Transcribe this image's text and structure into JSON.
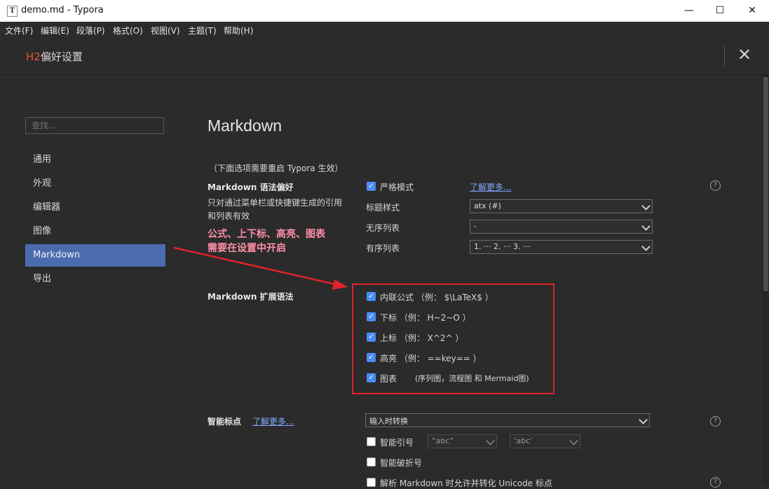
{
  "window": {
    "title": "demo.md - Typora",
    "app_icon": "T",
    "minimize": "—",
    "maximize": "☐",
    "close": "✕"
  },
  "menu": [
    "文件(F)",
    "编辑(E)",
    "段落(P)",
    "格式(O)",
    "视图(V)",
    "主题(T)",
    "帮助(H)"
  ],
  "preferences": {
    "header_prefix": "H2",
    "header_title": "偏好设置",
    "close_symbol": "✕"
  },
  "sidebar": {
    "search_placeholder": "查找...",
    "items": [
      "通用",
      "外观",
      "编辑器",
      "图像",
      "Markdown",
      "导出"
    ],
    "active": "Markdown"
  },
  "main": {
    "section_title": "Markdown",
    "restart_note": "（下面选项需要重启 Typora 生效）",
    "syntax_pref": {
      "title": "Markdown 语法偏好",
      "desc_line1": "只对通过菜单栏或快捷键生成的引用",
      "desc_line2": "和列表有效",
      "strict_label": "严格模式",
      "strict_checked": true,
      "learn_more": "了解更多...",
      "heading_label": "标题样式",
      "heading_value": "atx (#)",
      "unordered_label": "无序列表",
      "unordered_value": "-",
      "ordered_label": "有序列表",
      "ordered_value": "1. ··· 2. ··· 3. ···"
    },
    "annotation": {
      "line1": "公式、上下标、高亮、图表",
      "line2": "需要在设置中开启"
    },
    "ext_syntax": {
      "title": "Markdown 扩展语法",
      "options": [
        {
          "label": "内联公式 （例： $\\LaTeX$ ）",
          "checked": true
        },
        {
          "label": "下标 （例： H~2~O ）",
          "checked": true
        },
        {
          "label": "上标 （例： X^2^ ）",
          "checked": true
        },
        {
          "label": "高亮 （例： ==key== ）",
          "checked": true
        },
        {
          "label": "图表",
          "checked": true,
          "note": "(序列图，流程图 和 Mermaid图)"
        }
      ]
    },
    "smart_punct": {
      "title": "智能标点",
      "learn_more": "了解更多...",
      "mode_value": "输入时转换",
      "smart_quotes_label": "智能引号",
      "smart_quotes_checked": false,
      "double_quote_value": "“abc”",
      "single_quote_value": "‘abc’",
      "smart_dash_label": "智能破折号",
      "smart_dash_checked": false,
      "unicode_label": "解析 Markdown 时允许并转化 Unicode 标点",
      "unicode_checked": false
    }
  },
  "colors": {
    "background": "#2b2b2b",
    "accent_active": "#4b6bb0",
    "header_h2": "#e5533c",
    "annotation_pink": "#ff8ea8",
    "annotation_red": "#e0242a",
    "link": "#7fa9ff",
    "checkbox_on": "#4a8cf7"
  },
  "icons": {
    "help": "question-circle-icon",
    "close": "close-icon",
    "dropdown": "chevron-down-icon"
  }
}
